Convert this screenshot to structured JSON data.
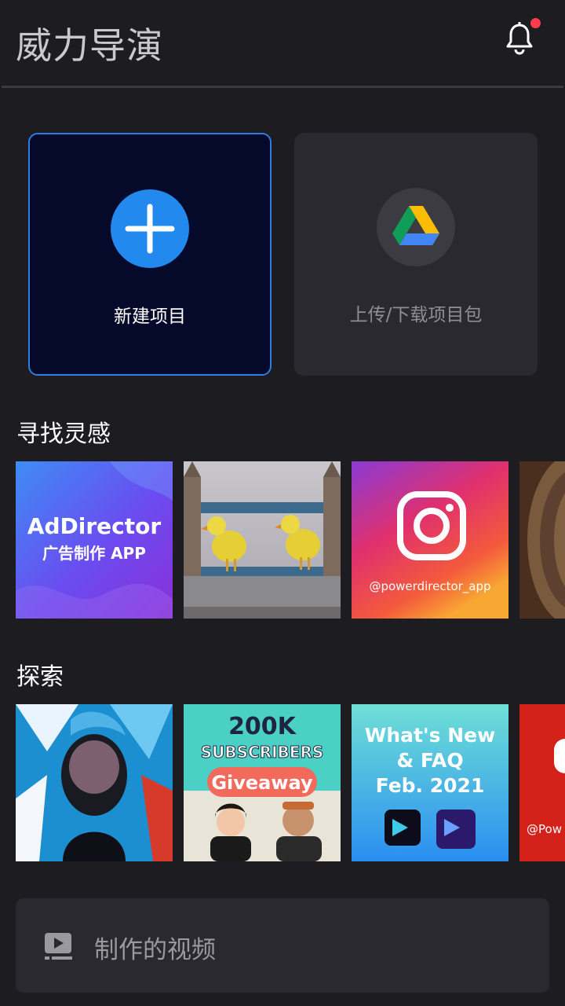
{
  "header": {
    "title": "威力导演"
  },
  "actions": {
    "new_project": "新建项目",
    "upload_download": "上传/下载项目包"
  },
  "inspiration": {
    "title": "寻找灵感",
    "items": [
      {
        "name": "addirector",
        "title": "AdDirector",
        "subtitle": "广告制作 APP"
      },
      {
        "name": "tower-bridge-ducks"
      },
      {
        "name": "instagram",
        "caption": "@powerdirector_app"
      },
      {
        "name": "wood-texture"
      }
    ]
  },
  "explore": {
    "title": "探索",
    "items": [
      {
        "name": "art-portrait"
      },
      {
        "name": "giveaway",
        "line1": "200K",
        "line2": "SUBSCRIBERS",
        "line3": "Giveaway"
      },
      {
        "name": "whats-new",
        "line1": "What's New",
        "line2": "& FAQ",
        "line3": "Feb. 2021"
      },
      {
        "name": "youtube",
        "caption": "@Pow"
      }
    ]
  },
  "bottom": {
    "label": "制作的视频"
  },
  "colors": {
    "accent": "#2289ee",
    "background": "#1d1c21",
    "card": "#2a292f",
    "notification": "#ff3b4e"
  }
}
